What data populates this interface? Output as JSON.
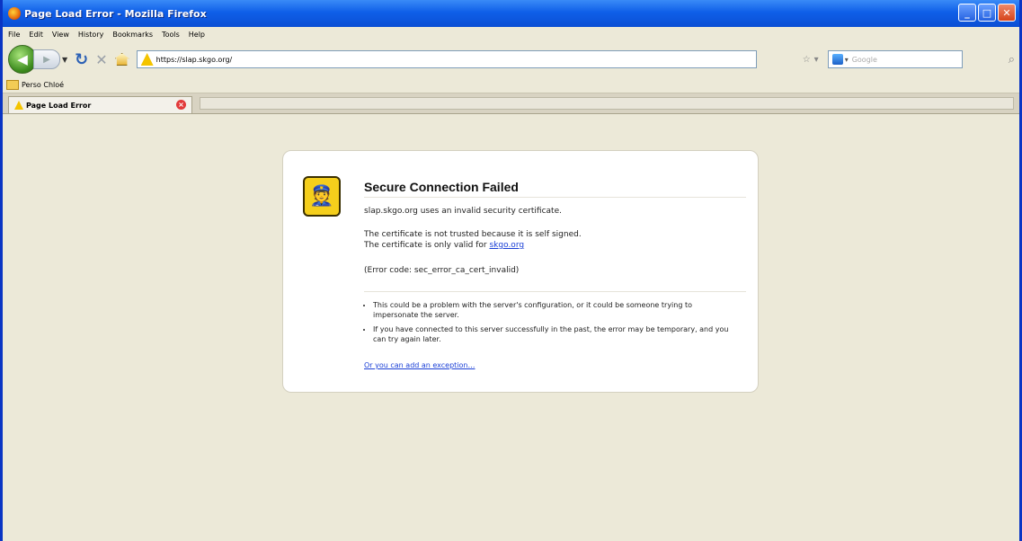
{
  "window": {
    "title": "Page Load Error - Mozilla Firefox"
  },
  "menu": [
    "File",
    "Edit",
    "View",
    "History",
    "Bookmarks",
    "Tools",
    "Help"
  ],
  "nav": {
    "url": "https://slap.skgo.org/",
    "search_placeholder": "Google"
  },
  "bookmarks": {
    "folder": "Perso Chloé"
  },
  "tab": {
    "label": "Page Load Error"
  },
  "error": {
    "title": "Secure Connection Failed",
    "line1": "slap.skgo.org uses an invalid security certificate.",
    "line2": "The certificate is not trusted because it is self signed.",
    "line3_prefix": "The certificate is only valid for ",
    "line3_link": "skgo.org",
    "code": "(Error code: sec_error_ca_cert_invalid)",
    "bullets": [
      "This could be a problem with the server's configuration, or it could be someone trying to impersonate the server.",
      "If you have connected to this server successfully in the past, the error may be temporary, and you can try again later."
    ],
    "exception_link": "Or you can add an exception…"
  }
}
